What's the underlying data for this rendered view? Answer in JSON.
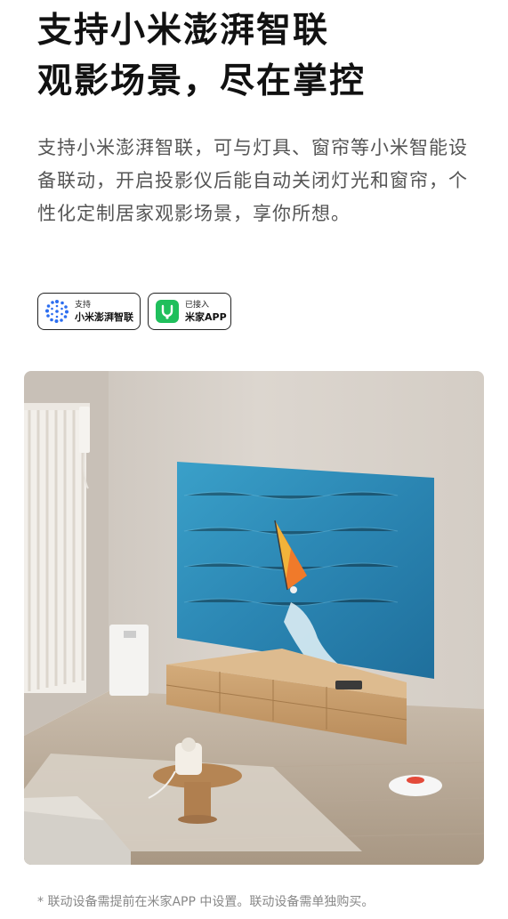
{
  "headline": {
    "line1": "支持小米澎湃智联",
    "line2": "观影场景，尽在掌控"
  },
  "description": "支持小米澎湃智联，可与灯具、窗帘等小米智能设备联动，开启投影仪后能自动关闭灯光和窗帘，个性化定制居家观影场景，享你所想。",
  "badges": [
    {
      "icon": "hyperos-connect-icon",
      "small": "支持",
      "big": "小米澎湃智联"
    },
    {
      "icon": "mijia-app-icon",
      "small": "已接入",
      "big": "米家APP"
    }
  ],
  "scene": {
    "alt_icon": "living-room-projector-scene",
    "colors": {
      "wall": "#d9d3cc",
      "floor": "#bfb3a4",
      "screen": "#2f88b4",
      "cabinet": "#c49b6c"
    }
  },
  "footnote": "*  联动设备需提前在米家APP 中设置。联动设备需单独购买。"
}
